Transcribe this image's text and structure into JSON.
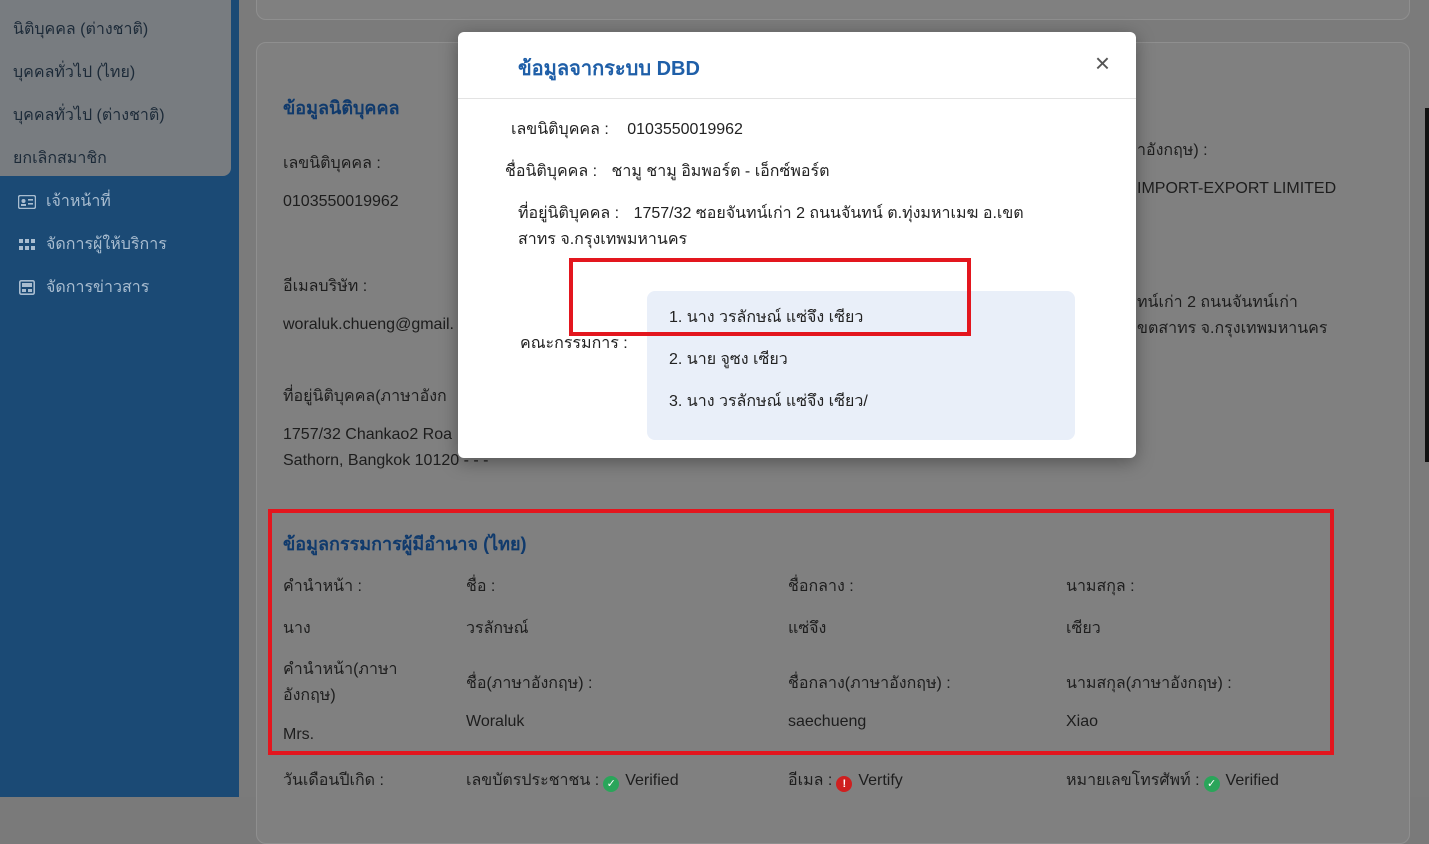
{
  "sidebar": {
    "submenu": [
      "นิติบุคคล (ต่างชาติ)",
      "บุคคลทั่วไป (ไทย)",
      "บุคคลทั่วไป (ต่างชาติ)",
      "ยกเลิกสมาชิก"
    ],
    "nav": [
      {
        "label": "เจ้าหน้าที่",
        "icon": "id-card-icon"
      },
      {
        "label": "จัดการผู้ให้บริการ",
        "icon": "grid-icon"
      },
      {
        "label": "จัดการข่าวสาร",
        "icon": "news-icon"
      }
    ]
  },
  "main": {
    "company_section": {
      "title": "ข้อมูลนิติบุคคล",
      "reg_no_label": "เลขนิติบุคคล :",
      "reg_no": "0103550019962",
      "email_label": "อีเมลบริษัท :",
      "email": "woraluk.chueng@gmail.",
      "address_en_label": "ที่อยู่นิติบุคคล(ภาษาอังก",
      "address_en_line1": "1757/32 Chankao2 Roa",
      "address_en_line2": "Sathorn, Bangkok 10120 - - -",
      "name_en_label": "าอังกฤษ) :",
      "name_en": "IMPORT-EXPORT LIMITED",
      "address_th_line1": "ทน์เก่า 2 ถนนจันทน์เก่า",
      "address_th_line2": "ขตสาทร จ.กรุงเทพมหานคร"
    },
    "director_section": {
      "title": "ข้อมูลกรรมการผู้มีอำนาจ (ไทย)",
      "prefix_label": "คำนำหน้า :",
      "first_label": "ชื่อ :",
      "middle_label": "ชื่อกลาง :",
      "last_label": "นามสกุล :",
      "prefix": "นาง",
      "first": "วรลักษณ์",
      "middle": "แซ่จึง",
      "last": "เซียว",
      "prefix_en_label_1": "คำนำหน้า(ภาษา",
      "prefix_en_label_2": "อังกฤษ)",
      "first_en_label": "ชื่อ(ภาษาอังกฤษ) :",
      "middle_en_label": "ชื่อกลาง(ภาษาอังกฤษ) :",
      "last_en_label": "นามสกุล(ภาษาอังกฤษ) :",
      "prefix_en": "Mrs.",
      "first_en": "Woraluk",
      "middle_en": "saechueng",
      "last_en": "Xiao"
    },
    "status_row": {
      "dob_label": "วันเดือนปีเกิด :",
      "id_label": "เลขบัตรประชาชน :",
      "id_status": "Verified",
      "email_label": "อีเมล :",
      "email_status": "Vertify",
      "phone_label": "หมายเลขโทรศัพท์ :",
      "phone_status": "Verified"
    }
  },
  "modal": {
    "title": "ข้อมูลจากระบบ DBD",
    "close": "×",
    "reg_no_label": "เลขนิติบุคคล :",
    "reg_no": "0103550019962",
    "name_label": "ชื่อนิติบุคคล :",
    "name": "ชามู ชามู อิมพอร์ต - เอ็กซ์พอร์ต",
    "address_label": "ที่อยู่นิติบุคคล :",
    "address_line1": "1757/32 ซอยจันทน์เก่า 2 ถนนจันทน์ ต.ทุ่งมหาเมฆ อ.เขต",
    "address_line2": "สาทร จ.กรุงเทพมหานคร",
    "directors_label": "คณะกรรมการ :",
    "directors": [
      "1. นาง วรลักษณ์ แซ่จึง เซียว",
      "2. นาย จูซง เซียว",
      "3. นาง วรลักษณ์ แซ่จึง เซียว/"
    ]
  },
  "colors": {
    "sidebar": "#1b4a75",
    "accent": "#1f5fa8",
    "highlight": "#e3161e",
    "verified": "#2aa55a",
    "warning": "#cf1f1f"
  }
}
